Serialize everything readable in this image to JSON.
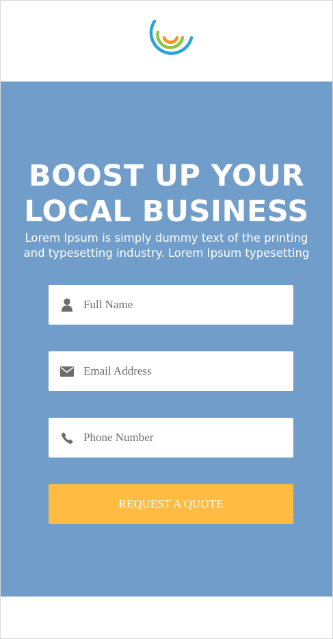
{
  "header": {
    "logo_icon": "brand-logo-arcs",
    "logo_colors": [
      "#29a3dd",
      "#8cc63f",
      "#f7941d"
    ]
  },
  "hero": {
    "background": "#719dca",
    "headline_line1": "BOOST UP YOUR",
    "headline_line2": "LOCAL BUSINESS",
    "subtext": "Lorem Ipsum is simply dummy text of the printing and typesetting industry. Lorem Ipsum typesetting"
  },
  "form": {
    "full_name": {
      "placeholder": "Full Name",
      "value": "",
      "icon": "user-icon"
    },
    "email": {
      "placeholder": "Email Address",
      "value": "",
      "icon": "envelope-icon"
    },
    "phone": {
      "placeholder": "Phone Number",
      "value": "",
      "icon": "phone-icon"
    },
    "submit_label": "REQUEST A QUOTE",
    "submit_color": "#ffbb42"
  }
}
